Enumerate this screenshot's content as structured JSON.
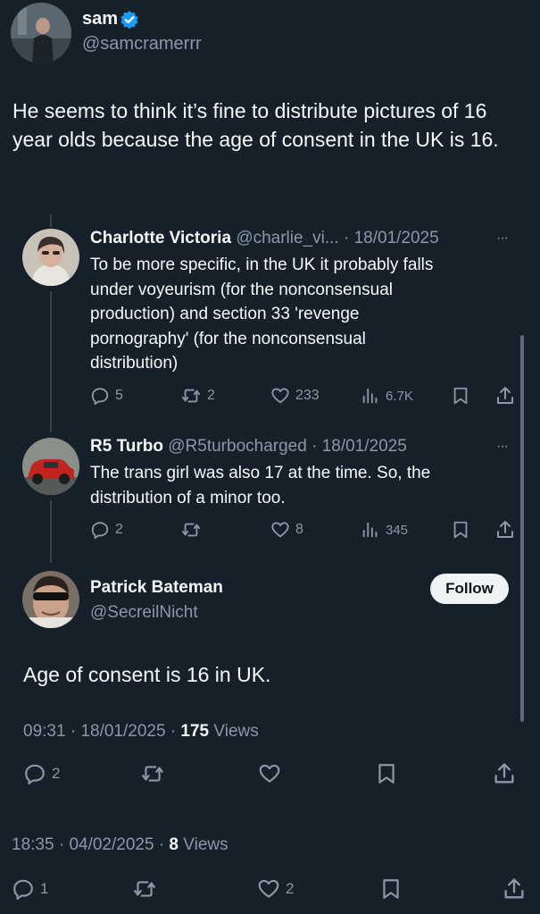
{
  "colors": {
    "background": "#15202b",
    "text": "#f7f9f9",
    "muted": "#8b98a5",
    "verified": "#1d9bf0",
    "follow_bg": "#eff3f4"
  },
  "main_post": {
    "name": "sam",
    "handle": "@samcramerrr",
    "text": "He seems to think it’s fine to distribute pictures of 16 year olds because the age of consent in the UK is 16."
  },
  "reply1": {
    "name": "Charlotte Victoria",
    "handle": "@charlie_vi...",
    "sep": "·",
    "date": "18/01/2025",
    "more": "···",
    "text": "To be more specific, in the UK it probably falls under voyeurism (for the nonconsensual production) and section 33 'revenge pornography' (for the nonconsensual distribution)",
    "replies": "5",
    "reposts": "2",
    "likes": "233",
    "views": "6.7K"
  },
  "reply2": {
    "name": "R5 Turbo",
    "handle": "@R5turbocharged",
    "sep": "·",
    "date": "18/01/2025",
    "more": "···",
    "text": "The trans girl was also 17 at the time. So, the distribution of a minor too.",
    "replies": "2",
    "likes": "8",
    "views": "345"
  },
  "focus_post": {
    "name": "Patrick Bateman",
    "handle": "@SecreilNicht",
    "follow_label": "Follow",
    "text": "Age of consent is 16 in UK.",
    "time": "09:31",
    "sep1": "·",
    "date": "18/01/2025",
    "sep2": "·",
    "views_count": "175",
    "views_label": "Views",
    "replies": "2"
  },
  "bottom_post": {
    "time": "18:35",
    "sep1": "·",
    "date": "04/02/2025",
    "sep2": "·",
    "views_count": "8",
    "views_label": "Views",
    "replies": "1",
    "likes": "2"
  }
}
